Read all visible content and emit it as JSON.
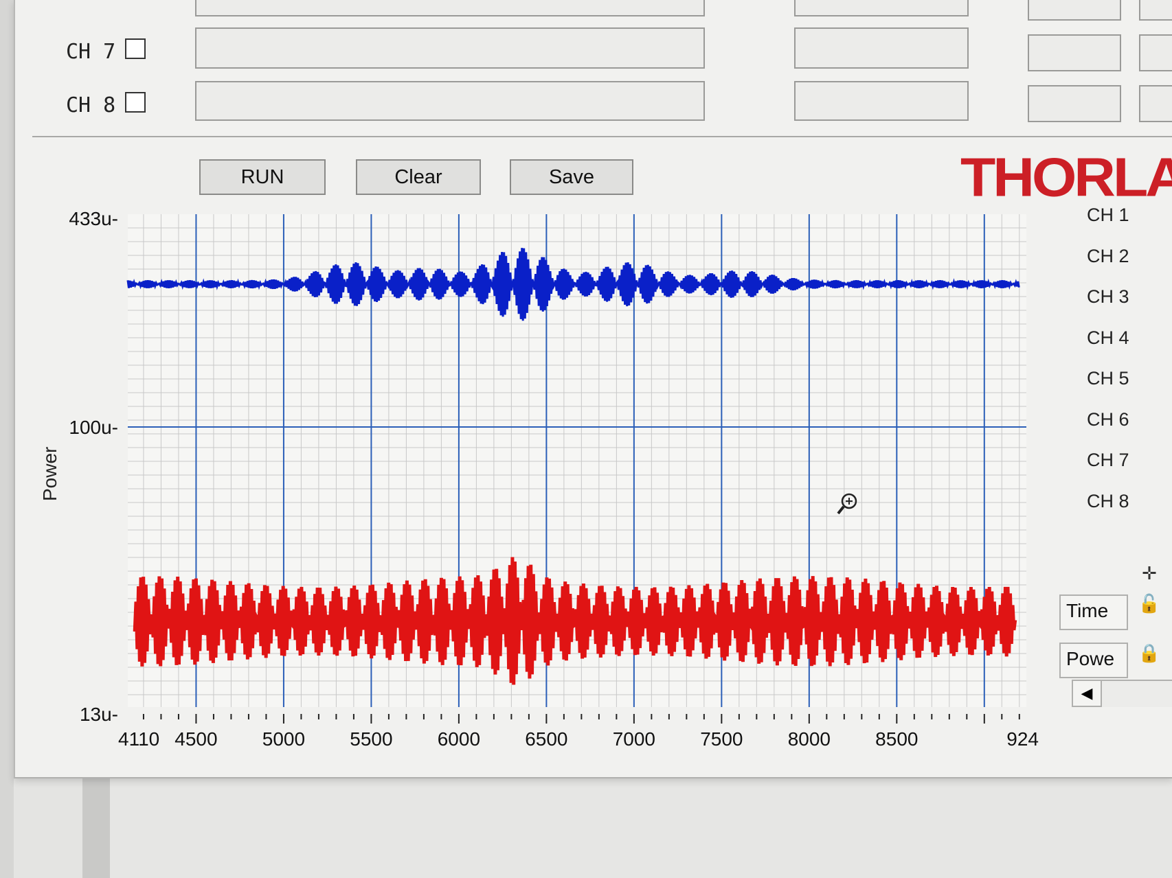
{
  "channels": [
    {
      "label": "CH 7"
    },
    {
      "label": "CH 8"
    }
  ],
  "buttons": {
    "run": "RUN",
    "clear": "Clear",
    "save": "Save"
  },
  "logo": {
    "text": "THORLA"
  },
  "legend": [
    "CH 1",
    "CH 2",
    "CH 3",
    "CH 4",
    "CH 5",
    "CH 6",
    "CH 7",
    "CH 8"
  ],
  "side_controls": {
    "time_label": "Time",
    "power_label": "Powe"
  },
  "colors": {
    "series1": "#0a20c8",
    "series2": "#e01414",
    "grid_major": "#2b5fb8",
    "grid_minor": "#c8c8c8",
    "logo": "#cc1f26"
  },
  "chart_data": {
    "type": "line",
    "ylabel": "Power",
    "ylim_labels": [
      "433u",
      "100u",
      "13u"
    ],
    "xlim": [
      4110,
      9240
    ],
    "x_tick_labels": [
      "4110",
      "4500",
      "5000",
      "5500",
      "6000",
      "6500",
      "7000",
      "7500",
      "8000",
      "8500",
      "924"
    ],
    "grid": true,
    "series": [
      {
        "color": "#0a20c8",
        "description_level": "upper band",
        "center_level_u": 290
      },
      {
        "color": "#e01414",
        "description_level": "lower band",
        "center_level_u": 30
      }
    ]
  }
}
